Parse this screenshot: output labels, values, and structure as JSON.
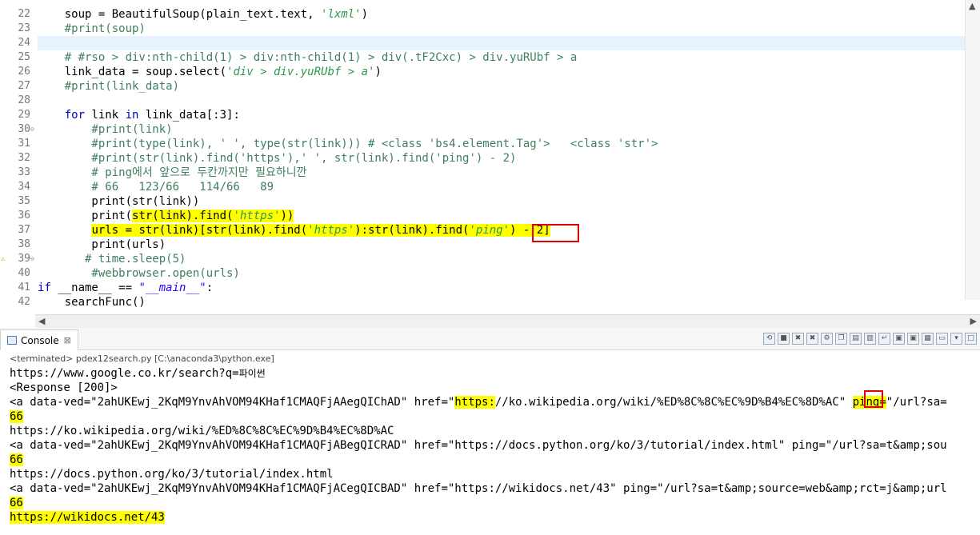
{
  "editor": {
    "lines": [
      {
        "num": "22",
        "text": "    soup = BeautifulSoup(plain_text.text, 'lxml')"
      },
      {
        "num": "23",
        "text": "    #print(soup)"
      },
      {
        "num": "24",
        "text": ""
      },
      {
        "num": "25",
        "text": "    # #rso > div:nth-child(1) > div:nth-child(1) > div(.tF2Cxc) > div.yuRUbf > a"
      },
      {
        "num": "26",
        "text": "    link_data = soup.select('div > div.yuRUbf > a')"
      },
      {
        "num": "27",
        "text": "    #print(link_data)"
      },
      {
        "num": "28",
        "text": ""
      },
      {
        "num": "29",
        "text": "    for link in link_data[:3]:"
      },
      {
        "num": "30",
        "text": "        #print(link)"
      },
      {
        "num": "31",
        "text": "        #print(type(link), ' ', type(str(link))) # <class 'bs4.element.Tag'>   <class 'str'>"
      },
      {
        "num": "32",
        "text": "        #print(str(link).find('https'),' ', str(link).find('ping') - 2)"
      },
      {
        "num": "33",
        "text": "        # ping에서 앞으로 두칸까지만 필요하니깐"
      },
      {
        "num": "34",
        "text": "        # 66   123/66   114/66   89"
      },
      {
        "num": "35",
        "text": "        print(str(link))"
      },
      {
        "num": "36",
        "text": "        print(str(link).find('https'))"
      },
      {
        "num": "37",
        "text": "        urls = str(link)[str(link).find('https'):str(link).find('ping') - 2]"
      },
      {
        "num": "38",
        "text": "        print(urls)"
      },
      {
        "num": "39",
        "text": "       # time.sleep(5)"
      },
      {
        "num": "40",
        "text": "        #webbrowser.open(urls)"
      },
      {
        "num": "41",
        "text": "if __name__ == \"__main__\":"
      },
      {
        "num": "42",
        "text": "    searchFunc()"
      }
    ]
  },
  "console": {
    "tab_label": "Console",
    "tab_close": "⊠",
    "terminated_line": "<terminated> pdex12search.py [C:\\anaconda3\\python.exe]",
    "output": [
      "https://www.google.co.kr/search?q=파이썬",
      "<Response [200]>",
      "<a data-ved=\"2ahUKEwj_2KqM9YnvAhVOM94KHaf1CMAQFjAAegQIChAD\" href=\"https://ko.wikipedia.org/wiki/%ED%8C%8C%EC%9D%B4%EC%8D%AC\" ping=\"/url?sa=",
      "66",
      "https://ko.wikipedia.org/wiki/%ED%8C%8C%EC%9D%B4%EC%8D%AC",
      "<a data-ved=\"2ahUKEwj_2KqM9YnvAhVOM94KHaf1CMAQFjABegQICRAD\" href=\"https://docs.python.org/ko/3/tutorial/index.html\" ping=\"/url?sa=t&amp;sou",
      "66",
      "https://docs.python.org/ko/3/tutorial/index.html",
      "<a data-ved=\"2ahUKEwj_2KqM9YnvAhVOM94KHaf1CMAQFjACegQICBAD\" href=\"https://wikidocs.net/43\" ping=\"/url?sa=t&amp;source=web&amp;rct=j&amp;url",
      "66",
      "https://wikidocs.net/43"
    ]
  },
  "icons": [
    "console-icon",
    "pin-icon",
    "stop-icon",
    "remove-launch-icon",
    "remove-all-icon",
    "debug-icon",
    "copy-icon",
    "clear-icon",
    "scroll-lock-icon",
    "word-wrap-icon",
    "show-stdout-icon",
    "show-stderr-icon",
    "pin-console-icon",
    "display-console-icon",
    "open-console-icon",
    "new-console-icon"
  ],
  "colors": {
    "highlight": "#ffff00",
    "box": "#e00000",
    "keyword": "#0000c0",
    "comment": "#3f7f5f",
    "string": "#2a9a4a"
  }
}
